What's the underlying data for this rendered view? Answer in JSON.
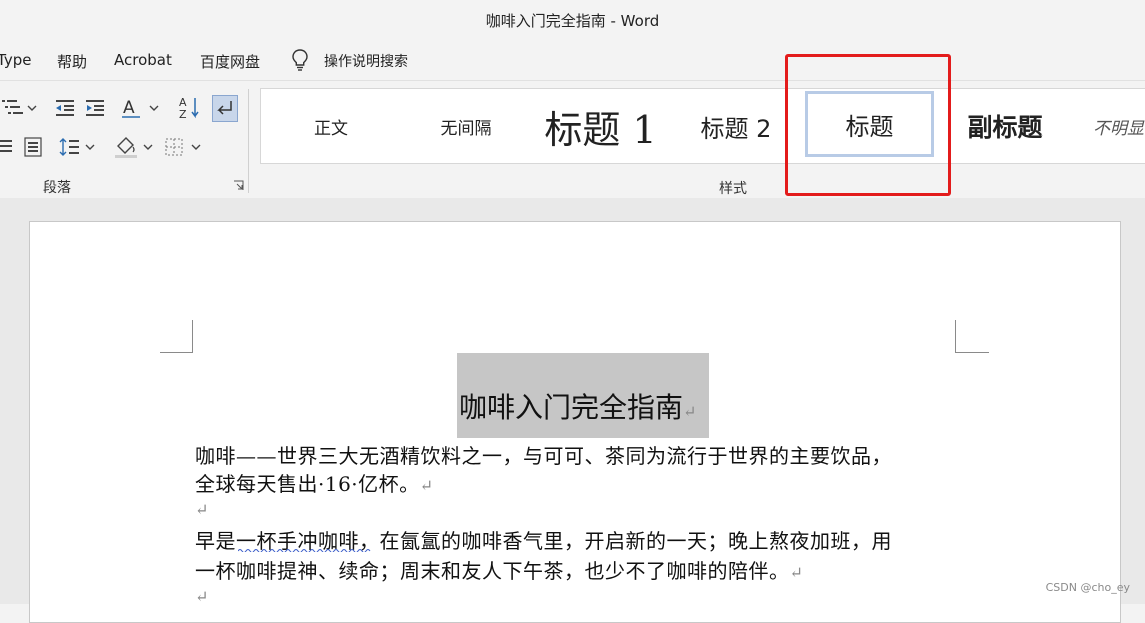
{
  "window": {
    "title": "咖啡入门完全指南  -  Word"
  },
  "tabs": [
    "Type",
    "帮助",
    "Acrobat",
    "百度网盘"
  ],
  "tell_me": {
    "label": "操作说明搜索",
    "icon": "lightbulb-icon"
  },
  "ribbon": {
    "paragraph_group_label": "段落",
    "styles_group_label": "样式",
    "styles": [
      "正文",
      "无间隔",
      "标题 1",
      "标题 2",
      "标题",
      "副标题",
      "不明显"
    ],
    "selected_style": "标题"
  },
  "highlight_color": "#e31b1b",
  "document": {
    "title": "咖啡入门完全指南",
    "paragraph1_line1": "咖啡——世界三大无酒精饮料之一，与可可、茶同为流行于世界的主要饮品，",
    "paragraph1_line2": "全球每天售出·16·亿杯。",
    "paragraph2_line1": "早是一杯手冲咖啡，在氤氲的咖啡香气里，开启新的一天；晚上熬夜加班，用",
    "paragraph2_line2": "一杯咖啡提神、续命；周末和友人下午茶，也少不了咖啡的陪伴。",
    "paragraph_mark": "↵"
  },
  "watermark": "CSDN @cho_ey"
}
